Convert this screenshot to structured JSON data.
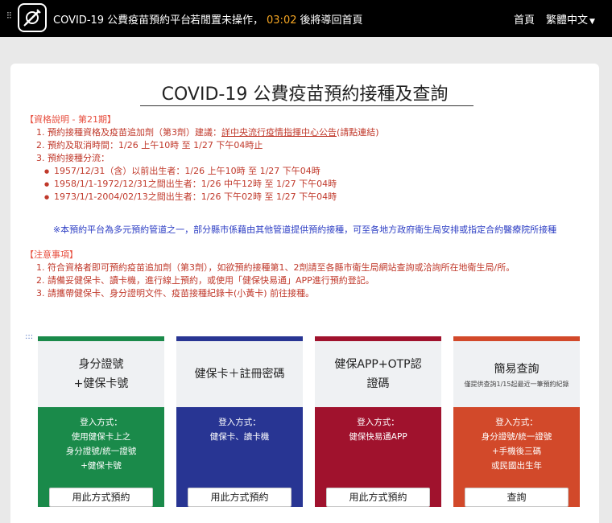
{
  "header": {
    "brand": "COVID-19 公費疫苗預約平台",
    "idle_prefix": "若閒置未操作，",
    "countdown": "03:02",
    "idle_suffix": "後將導回首頁",
    "nav_home": "首頁",
    "nav_lang": "繁體中文"
  },
  "page": {
    "title": "COVID-19 公費疫苗預約接種及查詢"
  },
  "eligibility": {
    "heading": "【資格說明 - 第21期】",
    "item1_prefix": "1. 預約接種資格及疫苗追加劑（第3劑）建議：",
    "item1_link": "詳中央流行疫情指揮中心公告",
    "item1_suffix": "(請點連結)",
    "item2": "2. 預約及取消時間：1/26 上午10時 至 1/27 下午04時止",
    "item3": "3. 預約接種分流：",
    "sub": [
      "1957/12/31（含）以前出生者：1/26 上午10時 至 1/27 下午04時",
      "1958/1/1-1972/12/31之間出生者：1/26 中午12時 至 1/27 下午04時",
      "1973/1/1-2004/02/13之間出生者：1/26 下午02時 至 1/27 下午04時"
    ]
  },
  "notice": "※本預約平台為多元預約管道之一，部分縣市係藉由其他管道提供預約接種，可至各地方政府衛生局安排或指定合約醫療院所接種",
  "precautions": {
    "heading": "【注意事項】",
    "items": [
      "1. 符合資格者即可預約疫苗追加劑（第3劑），如欲預約接種第1、2劑請至各縣市衛生局網站查詢或洽詢所在地衛生局/所。",
      "2. 請備妥健保卡、讀卡機，進行線上預約，或使用「健保快易通」APP進行預約登記。",
      "3. 請攜帶健保卡、身分證明文件、疫苗接種紀錄卡(小黃卡) 前往接種。"
    ]
  },
  "section_marker": ":::",
  "options": [
    {
      "name": "身分證號\n+健保卡號",
      "note": "",
      "login_text": "登入方式：\n使用健保卡上之\n身分證號/統一證號\n+健保卡號",
      "button": "用此方式預約",
      "color": "#1a8a4a"
    },
    {
      "name": "健保卡＋註冊密碼",
      "note": "",
      "login_text": "登入方式：\n健保卡、讀卡機",
      "button": "用此方式預約",
      "color": "#283593"
    },
    {
      "name": "健保APP+OTP認\n證碼",
      "note": "",
      "login_text": "登入方式：\n健保快易通APP",
      "button": "用此方式預約",
      "color": "#a0122d"
    },
    {
      "name": "簡易查詢",
      "note": "僅提供查詢1/15起最近一筆預約紀錄",
      "login_text": "登入方式：\n身分證號/統一證號\n+手機後三碼\n或民國出生年",
      "button": "查詢",
      "color": "#d2492a"
    }
  ]
}
